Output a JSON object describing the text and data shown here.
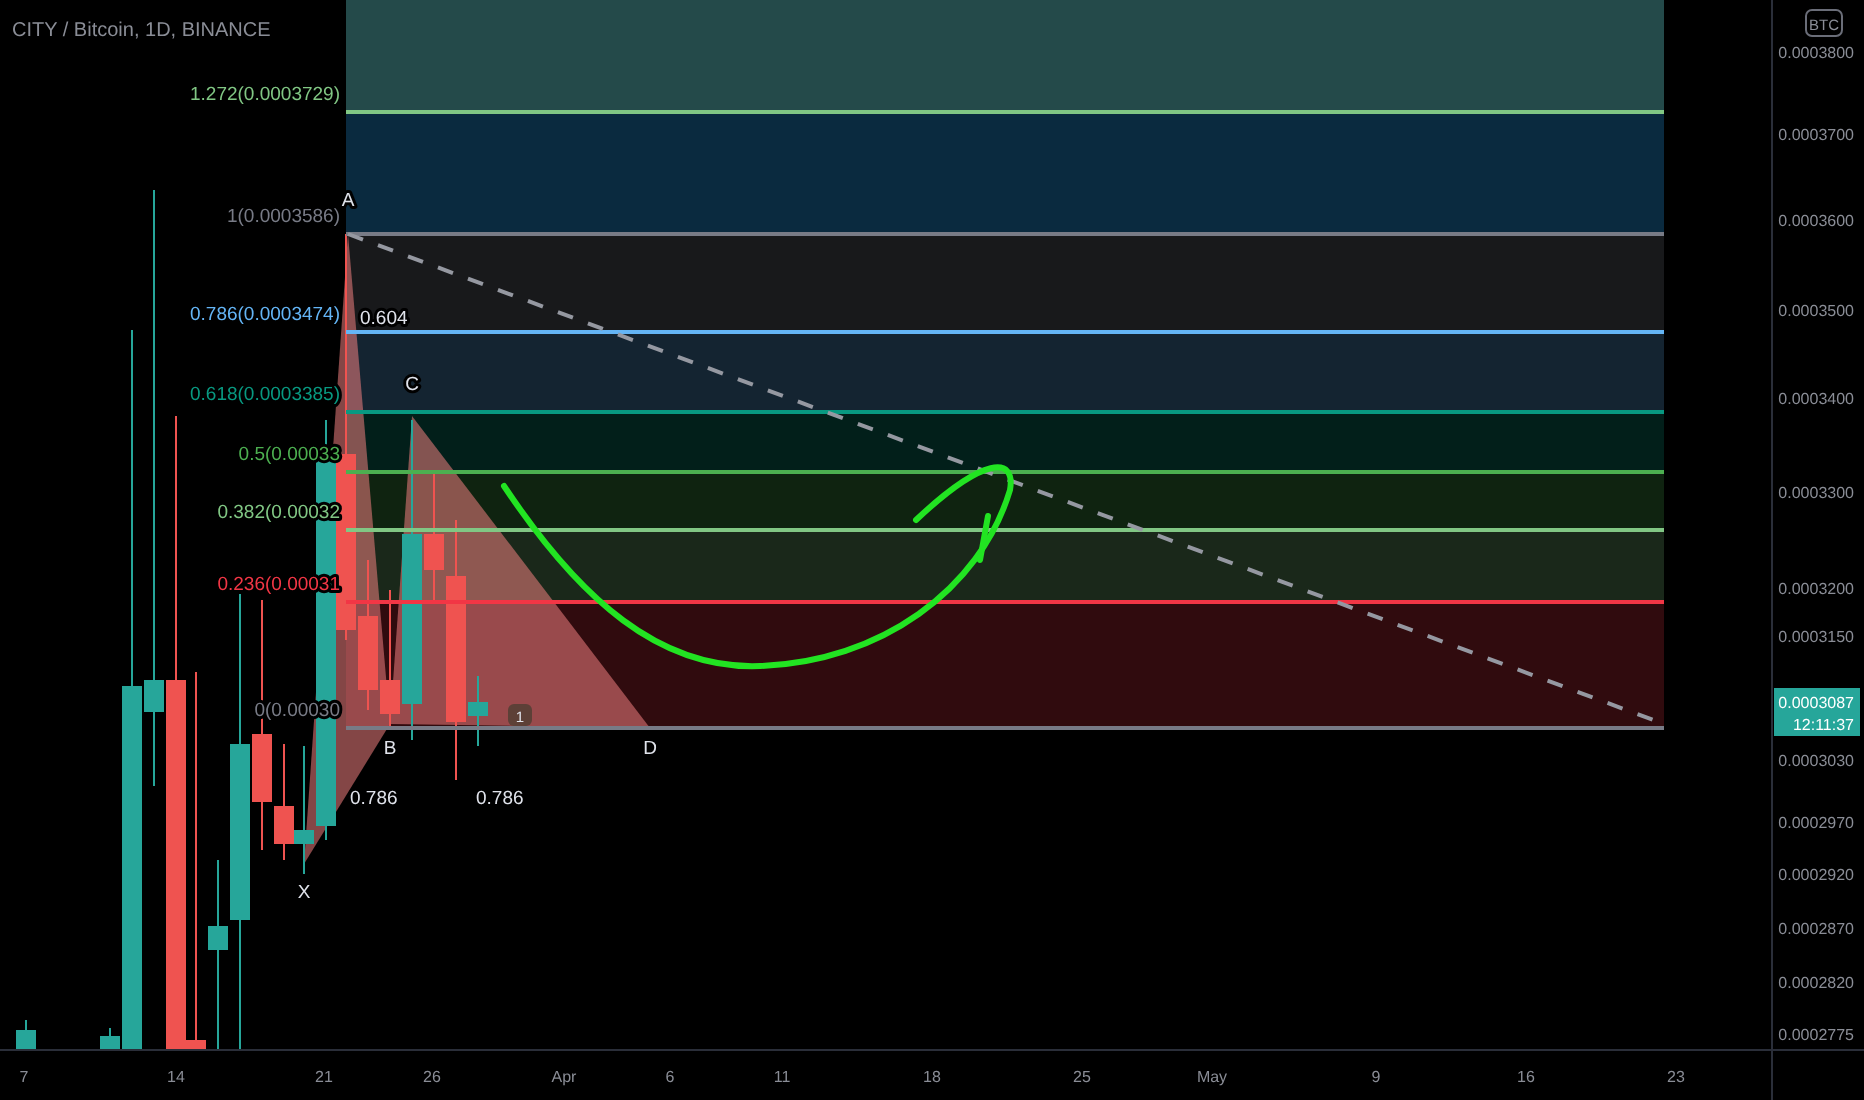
{
  "chart": {
    "title": "CITY / Bitcoin, 1D, BINANCE",
    "currency_badge": "BTC",
    "fib_levels": [
      {
        "label": "1.272(0.0003729)",
        "color": "#81c784"
      },
      {
        "label": "1(0.0003586)",
        "color": "#787b86"
      },
      {
        "label": "0.786(0.0003474)",
        "color": "#64b5f6"
      },
      {
        "label": "0.618(0.0003385)",
        "color": "#089981"
      },
      {
        "label": "0.5(0.00033",
        "color": "#4caf50"
      },
      {
        "label": "0.382(0.00032",
        "color": "#81c784"
      },
      {
        "label": "0.236(0.00031",
        "color": "#f23645"
      },
      {
        "label": "0(0.00030",
        "color": "#787b86"
      }
    ],
    "pattern_points": [
      "X",
      "A",
      "B",
      "C",
      "D"
    ],
    "ratio_labels": [
      "0.604",
      "0.786",
      "0.786"
    ],
    "bar_marker": "1",
    "price_axis": [
      "0.0003800",
      "0.0003700",
      "0.0003600",
      "0.0003500",
      "0.0003400",
      "0.0003300",
      "0.0003200",
      "0.0003150",
      "0.0003030",
      "0.0002970",
      "0.0002920",
      "0.0002870",
      "0.0002820",
      "0.0002775"
    ],
    "last_price": {
      "price": "0.0003087",
      "countdown": "12:11:37"
    },
    "time_axis": [
      "7",
      "14",
      "21",
      "26",
      "Apr",
      "6",
      "11",
      "18",
      "25",
      "May",
      "9",
      "16",
      "23"
    ]
  }
}
